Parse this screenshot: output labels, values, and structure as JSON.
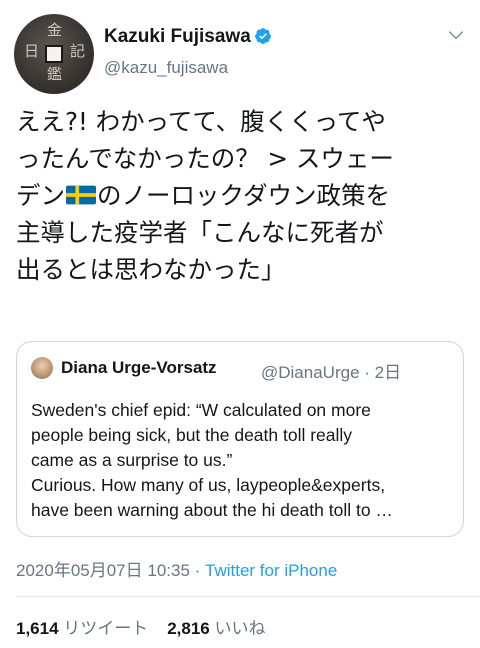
{
  "author": {
    "name": "Kazuki Fujisawa",
    "handle": "@kazu_fujisawa",
    "verified": true,
    "avatar_chars": [
      "金",
      "記",
      "日",
      "鑑"
    ]
  },
  "tweet": {
    "lines": [
      "ええ?! わかってて、腹くくってや",
      "ったんでなかったの？ > スウェー",
      "のノーロックダウン政策を",
      "主導した疫学者「こんなに死者が",
      "出るとは思わなかった」"
    ],
    "line3_prefix": "デン"
  },
  "quoted": {
    "name": "Diana Urge-Vorsatz",
    "handle": "@DianaUrge",
    "time": "· 2日",
    "lines": [
      "Sweden's chief epid: “W calculated on more",
      "people being sick, but the death toll really",
      "came as a surprise to us.”",
      "Curious. How many of us, laypeople&experts,",
      "have been warning about the hi death toll to …"
    ]
  },
  "meta": {
    "timestamp": "2020年05月07日 10:35",
    "separator": " · ",
    "source": "Twitter for iPhone"
  },
  "stats": {
    "retweets": "1,614",
    "retweets_label": "リツイート",
    "likes": "2,816",
    "likes_label": "いいね"
  },
  "colors": {
    "accent": "#1da1f2",
    "secondary_text": "#657786",
    "border": "#ccd6dd",
    "flag_blue": "#006aa7",
    "flag_yellow": "#fecc00"
  }
}
